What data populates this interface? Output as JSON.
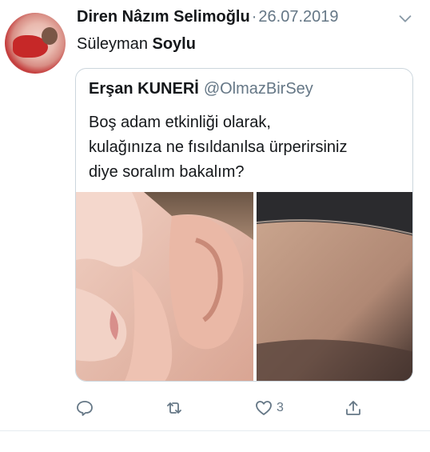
{
  "tweet": {
    "author_name": "Diren Nâzım Selimoğlu",
    "separator": "·",
    "date": "26.07.2019",
    "reply_prefix": "Süleyman",
    "reply_bold": "Soylu"
  },
  "quoted": {
    "name": "Erşan KUNERİ",
    "handle": "@OlmazBirSey",
    "text_lines": [
      "Boş adam etkinliği olarak,",
      "kulağınıza ne fısıldanılsa ürperirsiniz",
      "diye soralım bakalım?"
    ]
  },
  "actions": {
    "like_count": "3"
  },
  "icons": {
    "chevron": "chevron-down-icon",
    "reply": "reply-icon",
    "retweet": "retweet-icon",
    "like": "heart-icon",
    "share": "share-icon"
  },
  "colors": {
    "text": "#14171a",
    "muted": "#657786",
    "border": "#ccd6dd"
  }
}
